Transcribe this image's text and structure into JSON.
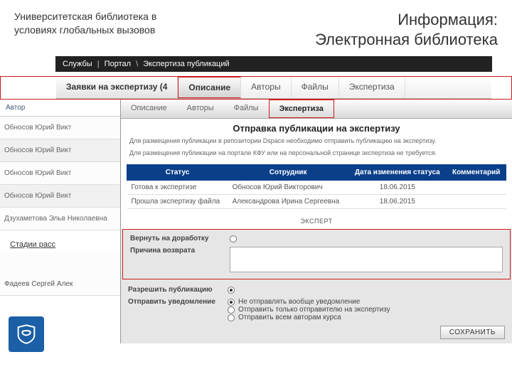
{
  "header": {
    "left": "Университетская библиотека в условиях глобальных вызовов",
    "right_line1": "Информация:",
    "right_line2": "Электронная библиотека"
  },
  "breadcrumb": {
    "a": "Службы",
    "b": "Портал",
    "c": "Экспертиза публикаций"
  },
  "tabs1": {
    "requests": "Заявки на экспертизу (4",
    "desc": "Описание",
    "authors": "Авторы",
    "files": "Файлы",
    "expertise": "Экспертиза"
  },
  "left": {
    "head": "Автор",
    "rows": [
      "Обносов Юрий Викт",
      "Обносов Юрий Викт",
      "Обносов Юрий Викт",
      "Обносов Юрий Викт",
      "Дзухаметова Эльв\nНиколаевна"
    ],
    "stage": "Стадии расс",
    "last": "Фадеев Сергей Алек"
  },
  "tabs2": {
    "desc": "Описание",
    "authors": "Авторы",
    "files": "Файлы",
    "expertise": "Экспертиза"
  },
  "section": {
    "title": "Отправка публикации на экспертизу",
    "sub1": "Для размещения публикации в репозитории Dspace необходимо отправить публикацию на экспертизу.",
    "sub2": "Для размещения публикации на портале КФУ или на персональной странице экспертиза не требуется."
  },
  "table": {
    "h1": "Статус",
    "h2": "Сотрудник",
    "h3": "Дата изменения статуса",
    "h4": "Комментарий",
    "rows": [
      {
        "c1": "Готова к экспертизе",
        "c2": "Обносов Юрий Викторович",
        "c3": "18.06.2015",
        "c4": ""
      },
      {
        "c1": "Прошла экспертизу файла",
        "c2": "Александрова Ирина Сергеевна",
        "c3": "18.06.2015",
        "c4": ""
      }
    ],
    "expert": "ЭКСПЕРТ"
  },
  "form": {
    "return_label": "Вернуть на доработку",
    "reason_label": "Причина возврата",
    "allow_label": "Разрешить публикацию",
    "notify_label": "Отправить уведомление",
    "opt1": "Не отправлять вообще уведомление",
    "opt2": "Отправить только отправителю на экспертизу",
    "opt3": "Отправить всем авторам курса",
    "save": "СОХРАНИТЬ"
  }
}
